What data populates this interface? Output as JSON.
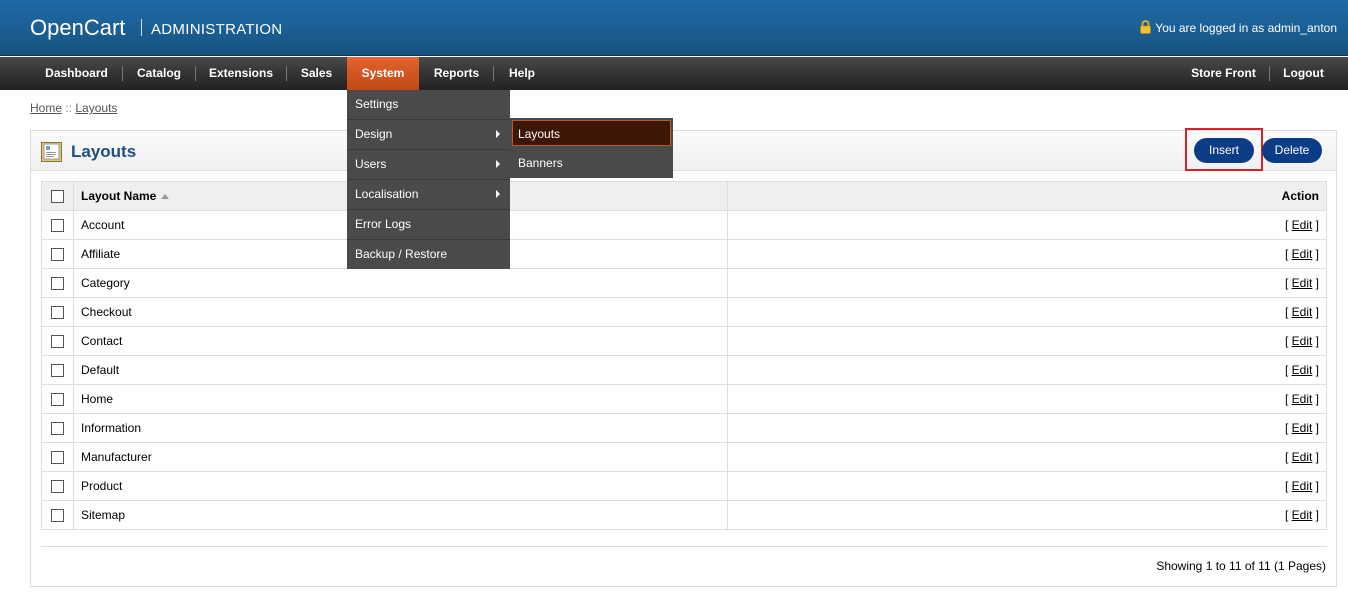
{
  "header": {
    "logo": "OpenCart",
    "subtitle": "ADMINISTRATION",
    "login_text": "You are logged in as admin_anton"
  },
  "menu": {
    "items": [
      {
        "label": "Dashboard"
      },
      {
        "label": "Catalog"
      },
      {
        "label": "Extensions"
      },
      {
        "label": "Sales"
      },
      {
        "label": "System"
      },
      {
        "label": "Reports"
      },
      {
        "label": "Help"
      }
    ],
    "right_items": [
      {
        "label": "Store Front"
      },
      {
        "label": "Logout"
      }
    ],
    "active": "System",
    "active_color": "#d3571f"
  },
  "system_dropdown": [
    {
      "label": "Settings"
    },
    {
      "label": "Design"
    },
    {
      "label": "Users"
    },
    {
      "label": "Localisation"
    },
    {
      "label": "Error Logs"
    },
    {
      "label": "Backup / Restore"
    }
  ],
  "design_submenu": [
    {
      "label": "Layouts"
    },
    {
      "label": "Banners"
    }
  ],
  "breadcrumb": {
    "home": "Home",
    "separator": "::",
    "current": "Layouts"
  },
  "page": {
    "title": "Layouts",
    "insert_label": "Insert",
    "delete_label": "Delete"
  },
  "table": {
    "headers": {
      "name": "Layout Name",
      "action": "Action"
    },
    "rows": [
      {
        "name": "Account",
        "action": "Edit"
      },
      {
        "name": "Affiliate",
        "action": "Edit"
      },
      {
        "name": "Category",
        "action": "Edit"
      },
      {
        "name": "Checkout",
        "action": "Edit"
      },
      {
        "name": "Contact",
        "action": "Edit"
      },
      {
        "name": "Default",
        "action": "Edit"
      },
      {
        "name": "Home",
        "action": "Edit"
      },
      {
        "name": "Information",
        "action": "Edit"
      },
      {
        "name": "Manufacturer",
        "action": "Edit"
      },
      {
        "name": "Product",
        "action": "Edit"
      },
      {
        "name": "Sitemap",
        "action": "Edit"
      }
    ]
  },
  "pagination": {
    "text": "Showing 1 to 11 of 11 (1 Pages)"
  },
  "colors": {
    "header_blue": "#1b5f95",
    "button_blue": "#0b3c86",
    "title_blue": "#1f4f82",
    "highlight_red": "#d81f2a"
  }
}
